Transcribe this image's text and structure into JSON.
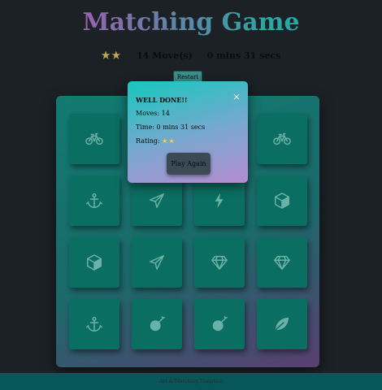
{
  "title": "Matching Game",
  "score_panel": {
    "stars": "★★",
    "moves": "14 Move(s)",
    "timer": "0 mins 31 secs"
  },
  "restart_label": "Restart",
  "cards": [
    {
      "icon": "bicycle-icon"
    },
    {
      "icon": "hidden"
    },
    {
      "icon": "hidden"
    },
    {
      "icon": "bicycle-icon"
    },
    {
      "icon": "anchor-icon"
    },
    {
      "icon": "paper-plane-icon"
    },
    {
      "icon": "bolt-icon"
    },
    {
      "icon": "cube-icon"
    },
    {
      "icon": "cube-icon"
    },
    {
      "icon": "paper-plane-icon"
    },
    {
      "icon": "diamond-icon"
    },
    {
      "icon": "diamond-icon"
    },
    {
      "icon": "anchor-icon"
    },
    {
      "icon": "bomb-icon"
    },
    {
      "icon": "bomb-icon"
    },
    {
      "icon": "leaf-icon"
    }
  ],
  "modal": {
    "heading": "WELL DONE!!",
    "moves_text": "Moves: 14",
    "time_text": "Time: 0 mins 31 secs",
    "rating_label": "Rating: ",
    "rating_stars": "★★",
    "close_glyph": "×",
    "play_again_label": "Play Again"
  },
  "footer_text": "Art & Matching Template",
  "colors": {
    "background": "#1c2126",
    "card": "#0b6e62",
    "icon": "#6ab2a8",
    "star": "#c2a94a"
  }
}
